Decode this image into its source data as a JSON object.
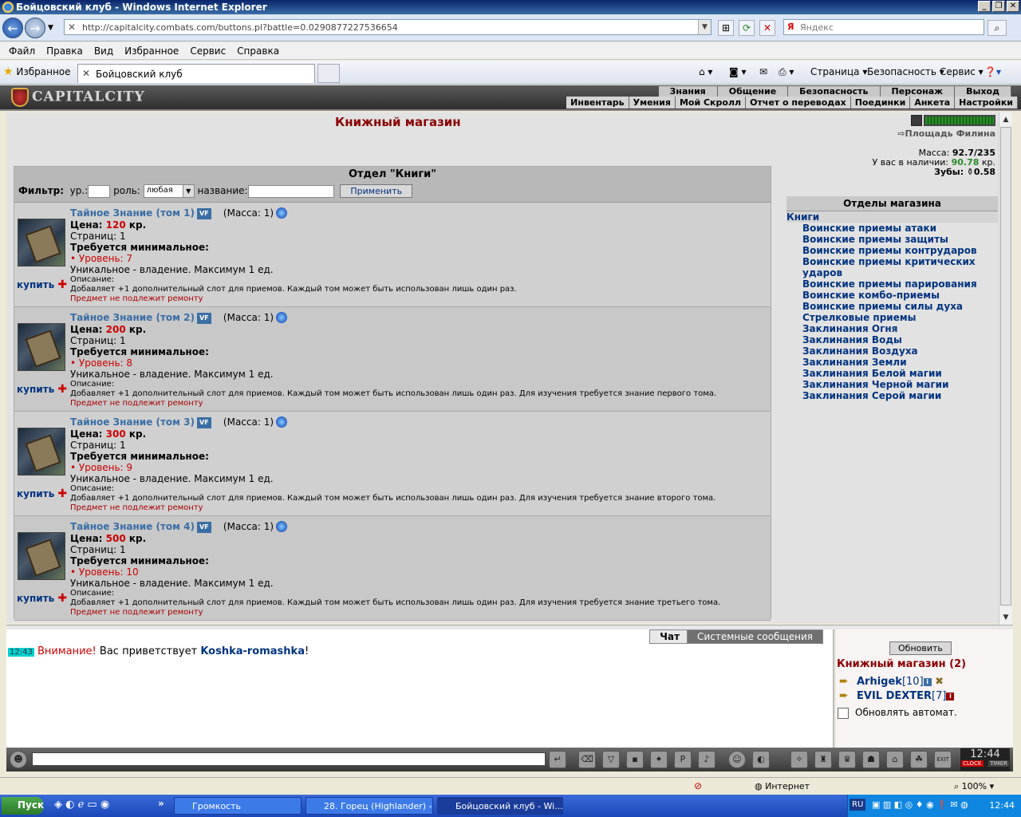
{
  "window": {
    "title": "Бойцовский клуб - Windows Internet Explorer"
  },
  "address": {
    "url": "http://capitalcity.combats.com/buttons.pl?battle=0.0290877227536654",
    "search_placeholder": "Яндекс",
    "search_brand": "Я"
  },
  "menu": [
    "Файл",
    "Правка",
    "Вид",
    "Избранное",
    "Сервис",
    "Справка"
  ],
  "favbar": {
    "favorites": "Избранное",
    "tab_title": "Бойцовский клуб",
    "page": "Страница",
    "security": "Безопасность",
    "service": "Сервис"
  },
  "gamenav": {
    "logo": "CAPITALCITY",
    "top": [
      "Знания",
      "Общение",
      "Безопасность",
      "Персонаж",
      "Выход"
    ],
    "bottom": [
      "Инвентарь",
      "Умения",
      "Мой Скролл",
      "Отчет о переводах",
      "Поединки",
      "Анкета",
      "Настройки"
    ]
  },
  "shop": {
    "title": "Книжный магазин",
    "location_link": "Площадь Филина",
    "mass_label": "Масса:",
    "mass_value": "92.7/235",
    "money_label": "У вас в наличии:",
    "money_value": "90.78",
    "money_unit": "кр.",
    "teeth_label": "Зубы:",
    "teeth_value": "0.58",
    "dept_title": "Отдел \"Книги\"",
    "filter": {
      "label": "Фильтр:",
      "level": "ур.:",
      "role": "роль:",
      "role_value": "любая",
      "name": "название:",
      "apply": "Применить"
    }
  },
  "items": [
    {
      "name": "Тайное Знание (том 1)",
      "mass": "(Масса: 1)",
      "price": "120",
      "pages": "Страниц: 1",
      "level": "• Уровень: 7",
      "desc": "Добавляет +1 дополнительный слот для приемов. Каждый том может быть использован лишь один раз."
    },
    {
      "name": "Тайное Знание (том 2)",
      "mass": "(Масса: 1)",
      "price": "200",
      "pages": "Страниц: 1",
      "level": "• Уровень: 8",
      "desc": "Добавляет +1 дополнительный слот для приемов. Каждый том может быть использован лишь один раз. Для изучения требуется знание первого тома."
    },
    {
      "name": "Тайное Знание (том 3)",
      "mass": "(Масса: 1)",
      "price": "300",
      "pages": "Страниц: 1",
      "level": "• Уровень: 9",
      "desc": "Добавляет +1 дополнительный слот для приемов. Каждый том может быть использован лишь один раз. Для изучения требуется знание второго тома."
    },
    {
      "name": "Тайное Знание (том 4)",
      "mass": "(Масса: 1)",
      "price": "500",
      "pages": "Страниц: 1",
      "level": "• Уровень: 10",
      "desc": "Добавляет +1 дополнительный слот для приемов. Каждый том может быть использован лишь один раз. Для изучения требуется знание третьего тома."
    }
  ],
  "item_labels": {
    "price": "Цена:",
    "unit": "кр.",
    "required": "Требуется минимальное:",
    "unique": "Уникальное - владение. Максимум 1 ед.",
    "desc_label": "Описание:",
    "norepair": "Предмет не подлежит ремонту",
    "buy": "купить",
    "vf": "VF"
  },
  "departments": {
    "title": "Отделы магазина",
    "current": "Книги",
    "list": [
      "Воинские приемы атаки",
      "Воинские приемы защиты",
      "Воинские приемы контрударов",
      "Воинские приемы критических ударов",
      "Воинские приемы парирования",
      "Воинские комбо-приемы",
      "Воинские приемы силы духа",
      "Стрелковые приемы",
      "Заклинания Огня",
      "Заклинания Воды",
      "Заклинания Воздуха",
      "Заклинания Земли",
      "Заклинания Белой магии",
      "Заклинания Черной магии",
      "Заклинания Серой магии"
    ]
  },
  "chat": {
    "tab_chat": "Чат",
    "tab_system": "Системные сообщения",
    "time": "12:43",
    "warning": "Внимание!",
    "greeting": "Вас приветствует",
    "nick": "Koshka-romashka",
    "end": "!"
  },
  "online": {
    "refresh": "Обновить",
    "title": "Книжный магазин (2)",
    "users": [
      {
        "name": "Arhigek",
        "level": "[10]"
      },
      {
        "name": "EVIL DEXTER",
        "level": "[7]"
      }
    ],
    "auto": "Обновлять автомат."
  },
  "clock": {
    "time": "12:44",
    "clock_label": "CLOCK",
    "timer_label": "TIMER"
  },
  "statusbar": {
    "zone": "Интернет",
    "zoom": "100%"
  },
  "taskbar": {
    "start": "Пуск",
    "tasks": [
      "Громкость",
      "28. Горец (Highlander) -...",
      "Бойцовский клуб - Wi..."
    ],
    "lang": "RU",
    "time": "12:44"
  }
}
